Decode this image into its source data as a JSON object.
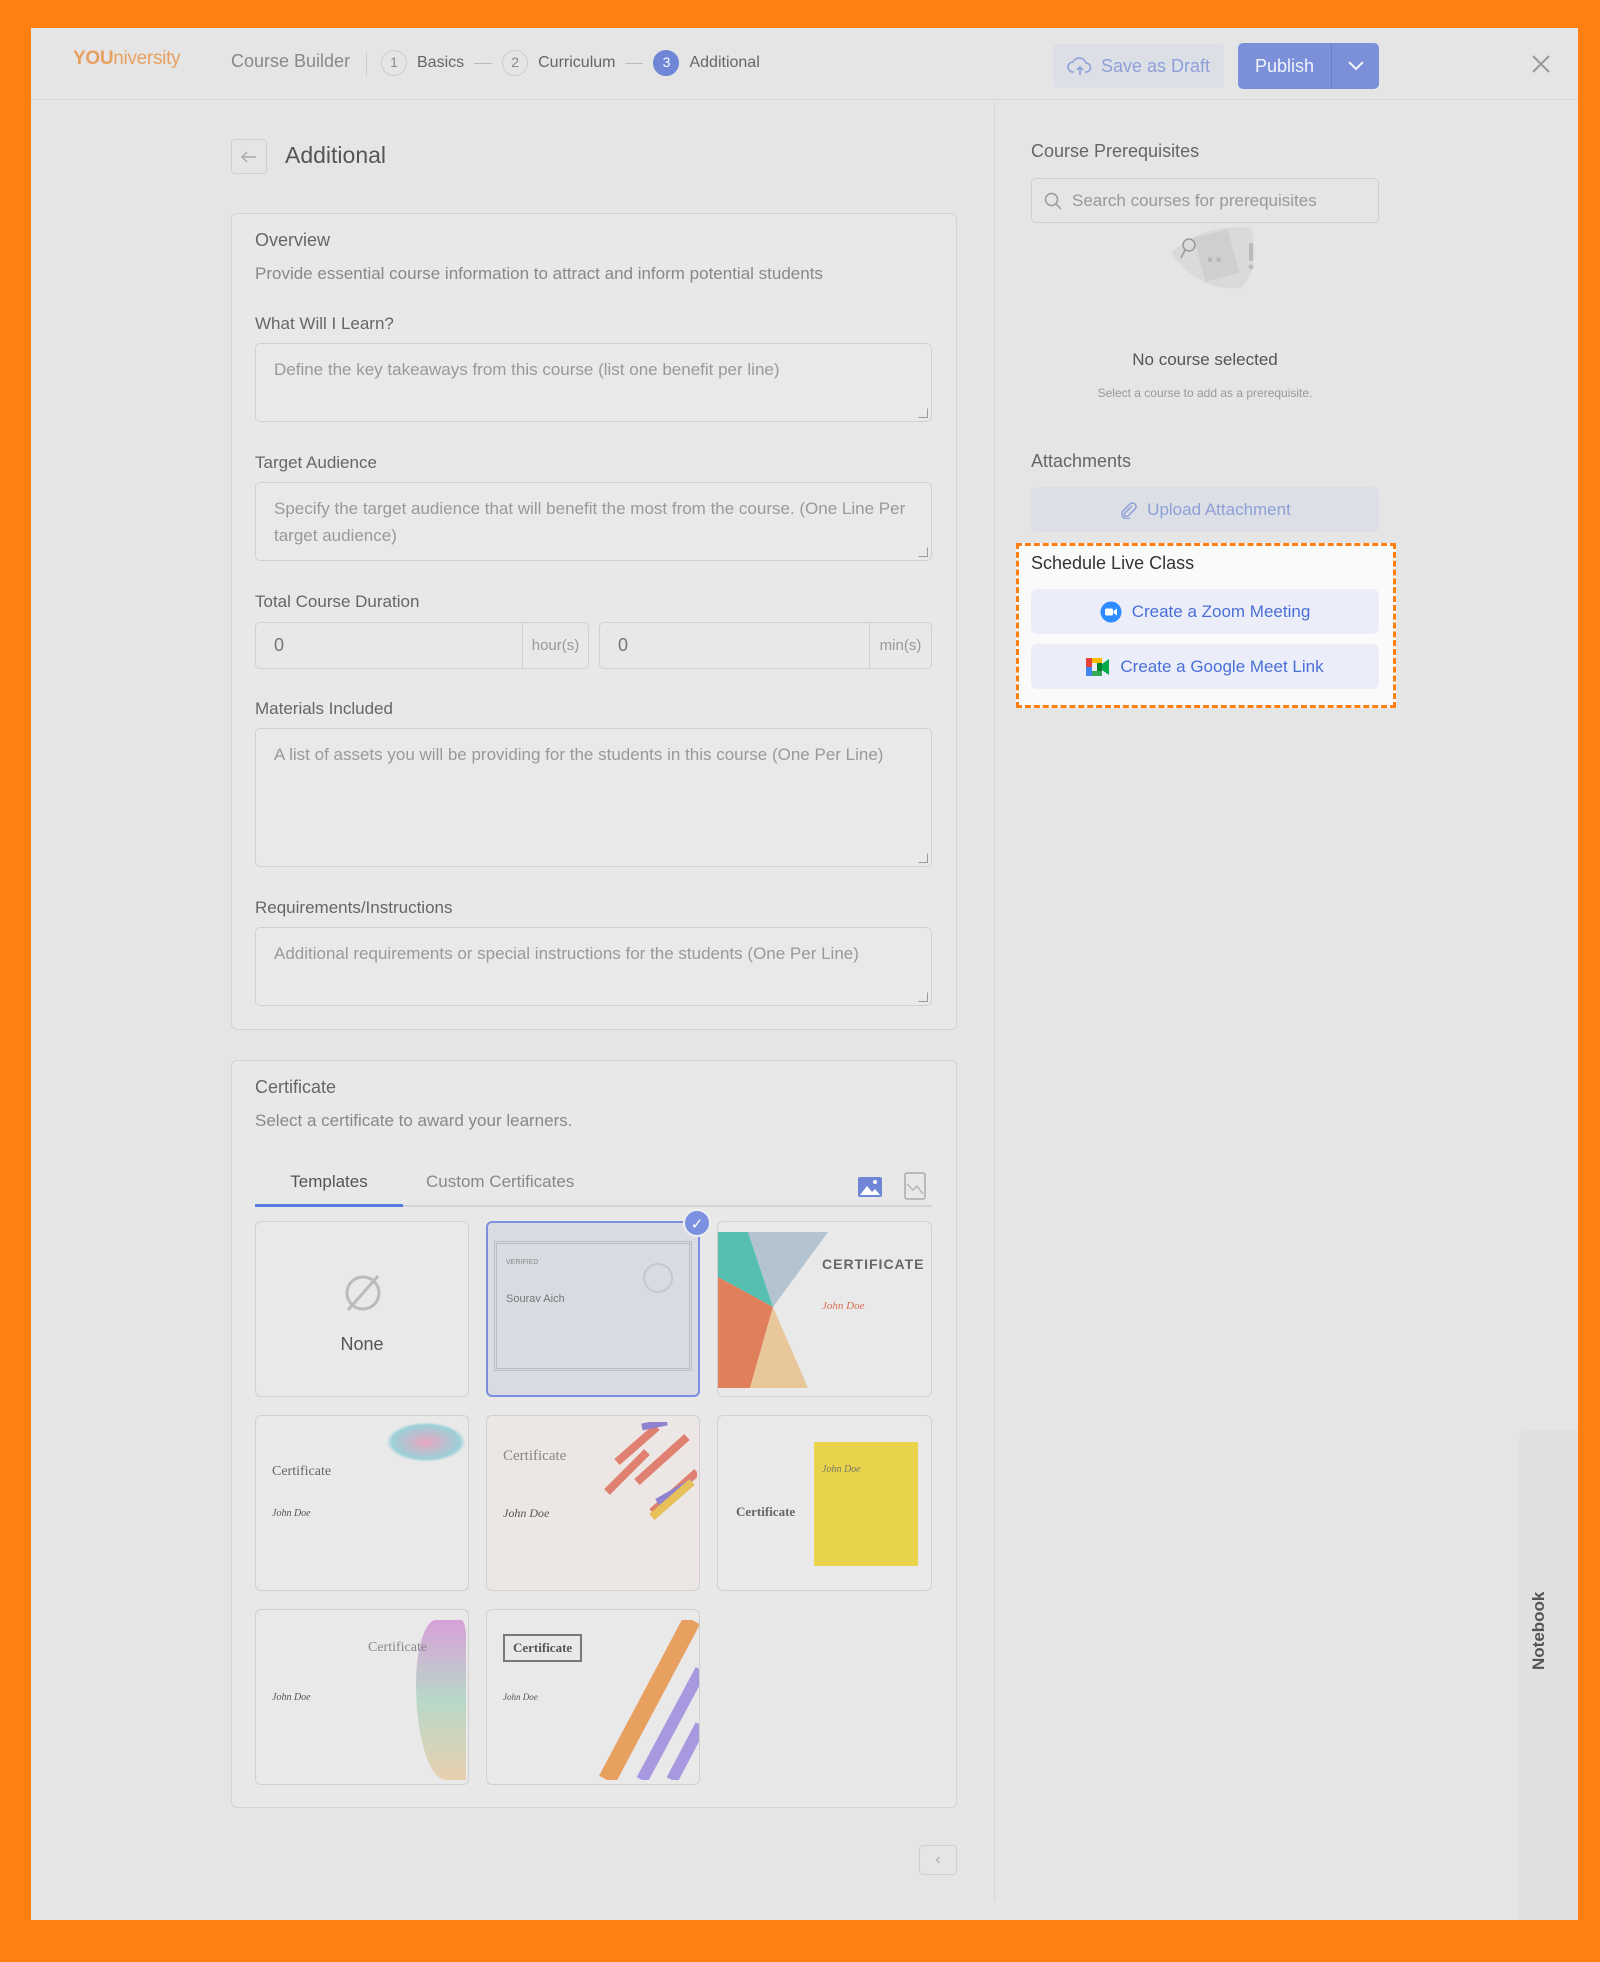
{
  "header": {
    "logo": {
      "you": "YOU",
      "rest": "niversity"
    },
    "title": "Course Builder",
    "steps": [
      {
        "num": "1",
        "label": "Basics"
      },
      {
        "num": "2",
        "label": "Curriculum"
      },
      {
        "num": "3",
        "label": "Additional",
        "active": true
      }
    ],
    "save_draft": "Save as Draft",
    "publish": "Publish"
  },
  "page": {
    "title": "Additional"
  },
  "overview": {
    "title": "Overview",
    "description": "Provide essential course information to attract and inform potential students",
    "learn": {
      "label": "What Will I Learn?",
      "placeholder": "Define the key takeaways from this course (list one benefit per line)"
    },
    "audience": {
      "label": "Target Audience",
      "placeholder": "Specify the target audience that will benefit the most from the course. (One Line Per target audience)"
    },
    "duration": {
      "label": "Total Course Duration",
      "hours": "0",
      "hours_unit": "hour(s)",
      "minutes": "0",
      "minutes_unit": "min(s)"
    },
    "materials": {
      "label": "Materials Included",
      "placeholder": "A list of assets you will be providing for the students in this course (One Per Line)"
    },
    "requirements": {
      "label": "Requirements/Instructions",
      "placeholder": "Additional requirements or special instructions for the students (One Per Line)"
    }
  },
  "certificate": {
    "title": "Certificate",
    "description": "Select a certificate to award your learners.",
    "tabs": [
      {
        "label": "Templates",
        "active": true
      },
      {
        "label": "Custom Certificates"
      }
    ],
    "templates": {
      "none": "None",
      "t1_name": "Sourav Aich",
      "t1_verified": "VERIFIED",
      "t2_title": "CERTIFICATE",
      "john": "John Doe",
      "cert": "Certificate"
    },
    "selected_index": 1
  },
  "sidebar": {
    "prereq_title": "Course Prerequisites",
    "search_placeholder": "Search courses for prerequisites",
    "empty_title": "No course selected",
    "empty_desc": "Select a course to add as a prerequisite.",
    "attachments_title": "Attachments",
    "upload": "Upload Attachment",
    "live_title": "Schedule Live Class",
    "zoom": "Create a Zoom Meeting",
    "meet": "Create a Google Meet Link"
  },
  "notebook": "Notebook",
  "colors": {
    "accent": "#6f87d6",
    "highlight": "#ff7f11",
    "link": "#4a6fd8"
  }
}
